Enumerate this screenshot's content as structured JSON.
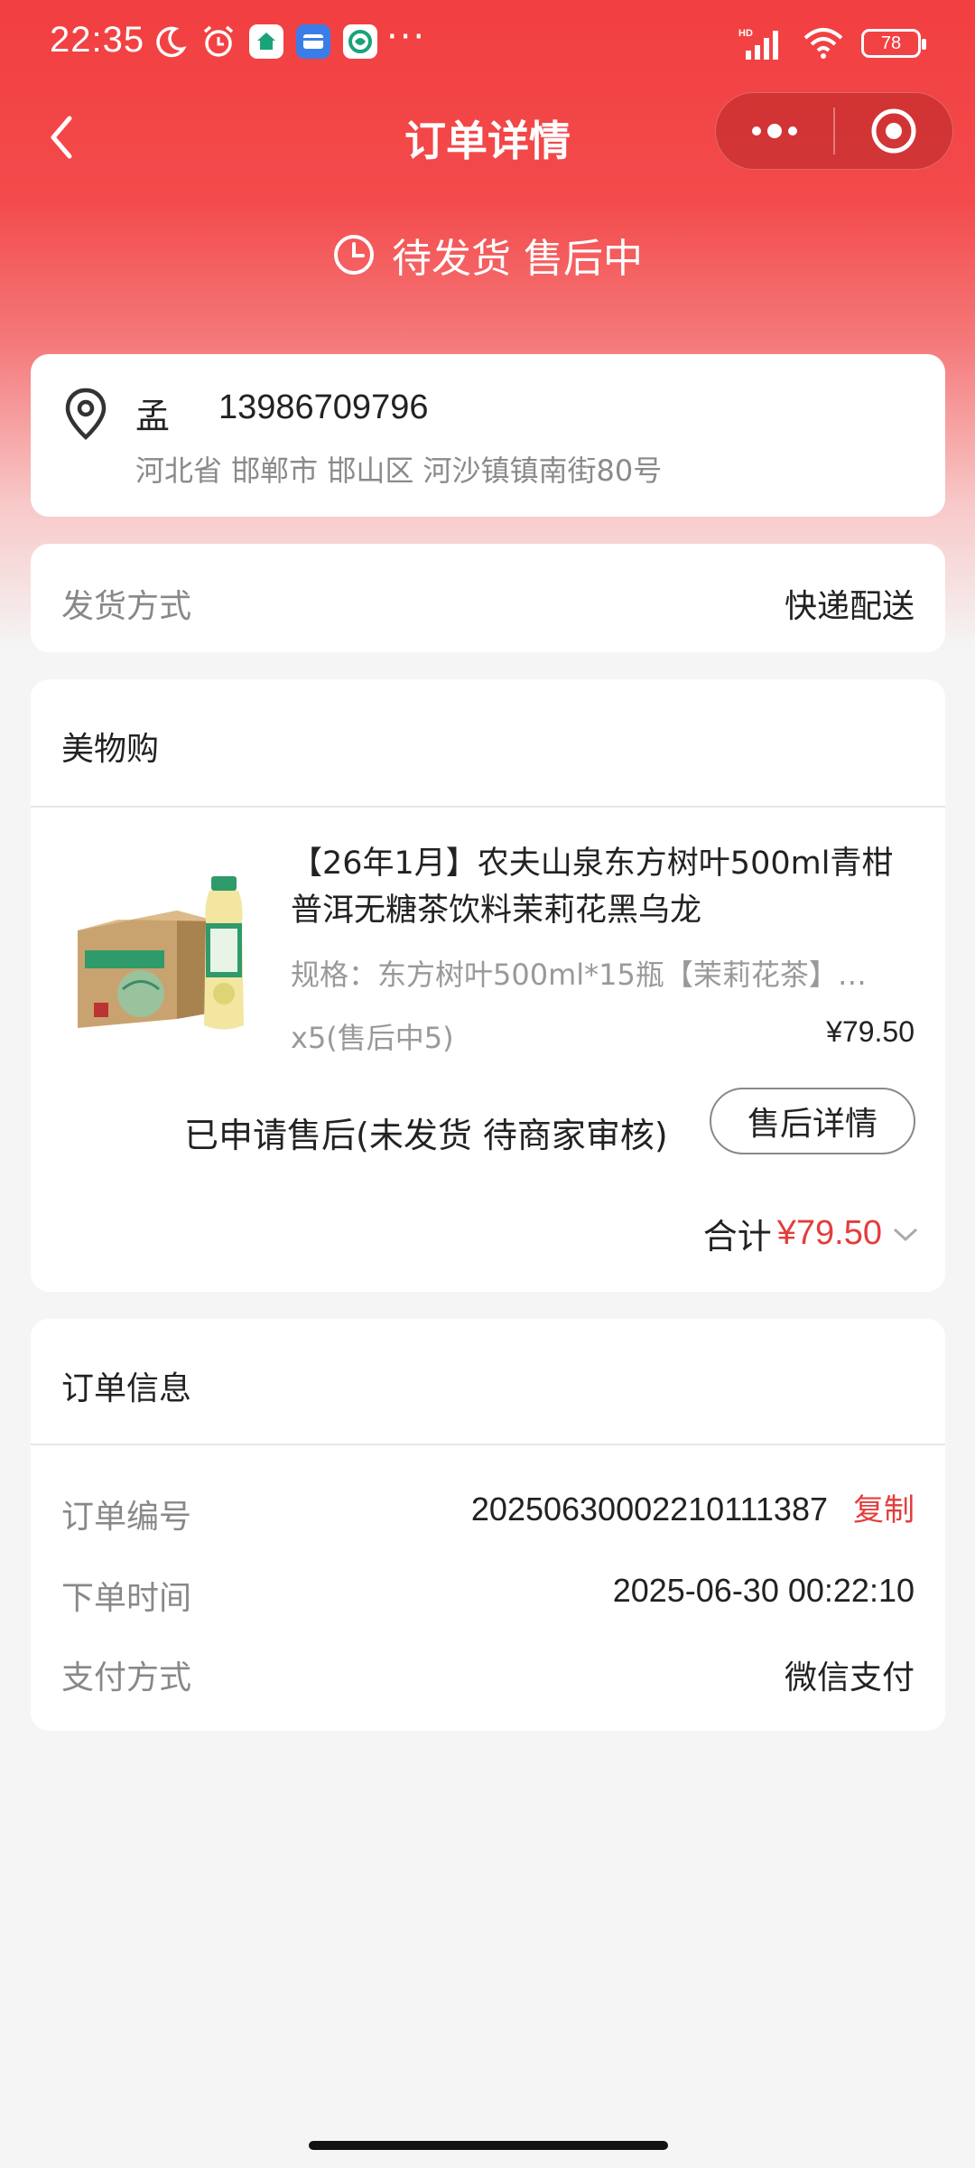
{
  "status_bar": {
    "time": "22:35",
    "battery": "78"
  },
  "nav": {
    "title": "订单详情"
  },
  "order_status": {
    "text": "待发货 售后中"
  },
  "address": {
    "name": "孟",
    "phone": "13986709796",
    "detail": "河北省 邯郸市 邯山区 河沙镇镇南街80号"
  },
  "shipping": {
    "label": "发货方式",
    "value": "快递配送"
  },
  "shop": {
    "name": "美物购",
    "product": {
      "title": "【26年1月】农夫山泉东方树叶500ml青柑普洱无糖茶饮料茉莉花黑乌龙",
      "spec": "规格：东方树叶500ml*15瓶【茉莉花茶】…",
      "quantity": "x5(售后中5)",
      "price": "¥79.50",
      "aftersale_status": "已申请售后(未发货 待商家审核)",
      "aftersale_button": "售后详情"
    },
    "total_label": "合计",
    "total_value": "¥79.50"
  },
  "order_info": {
    "title": "订单信息",
    "order_no_label": "订单编号",
    "order_no": "20250630002210111387",
    "copy_label": "复制",
    "time_label": "下单时间",
    "time": "2025-06-30 00:22:10",
    "payment_label": "支付方式",
    "payment": "微信支付"
  },
  "colors": {
    "header_red": "#f23f41",
    "accent_red": "#e33d3d",
    "background": "#f5f5f5"
  }
}
